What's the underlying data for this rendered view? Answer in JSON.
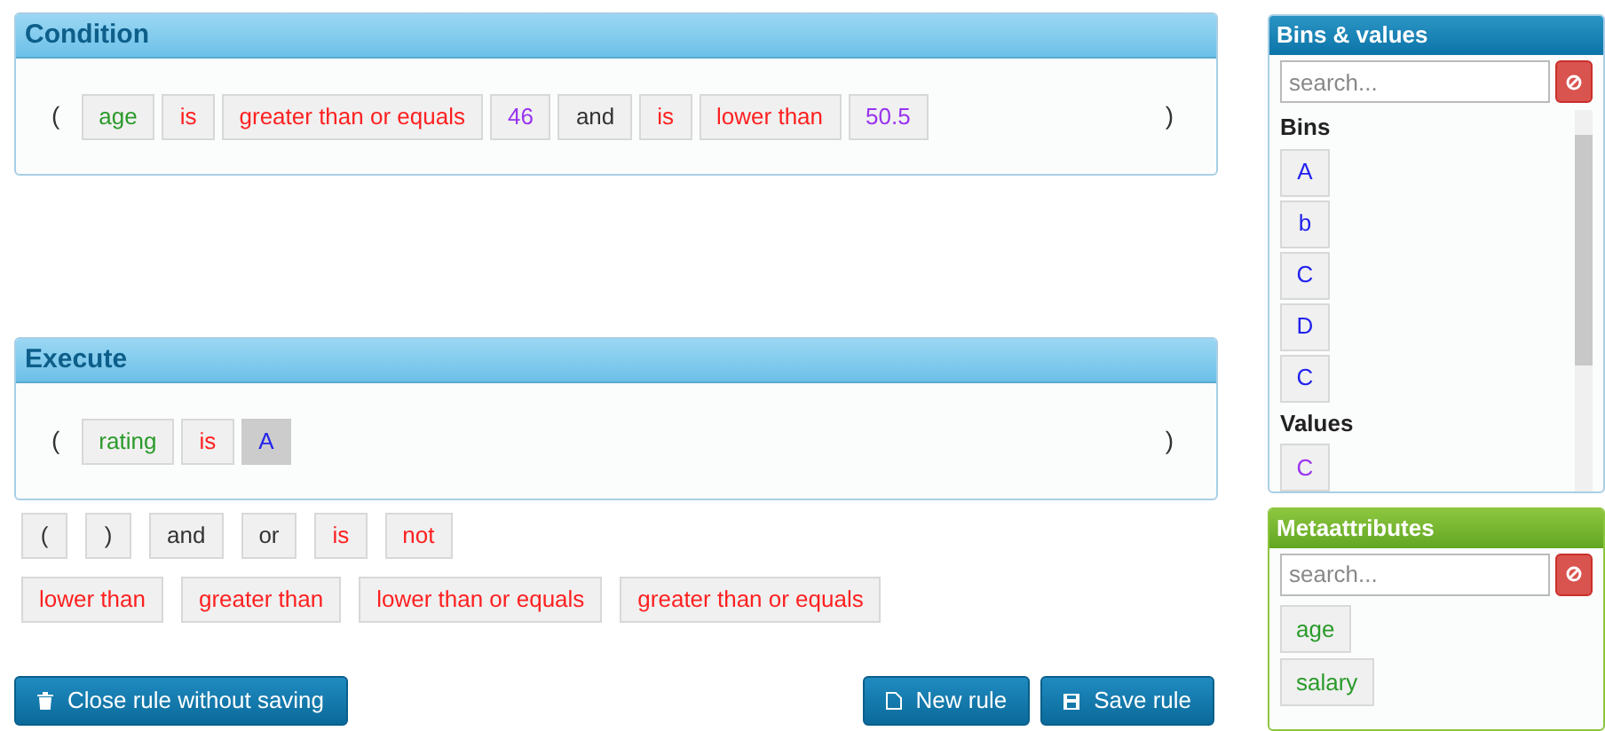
{
  "condition": {
    "title": "Condition",
    "open": "(",
    "close": ")",
    "tokens": [
      {
        "text": "age",
        "kind": "attribute"
      },
      {
        "text": "is",
        "kind": "operator"
      },
      {
        "text": "greater than or equals",
        "kind": "operator"
      },
      {
        "text": "46",
        "kind": "value"
      },
      {
        "text": "and",
        "kind": "logic"
      },
      {
        "text": "is",
        "kind": "operator"
      },
      {
        "text": "lower than",
        "kind": "operator"
      },
      {
        "text": "50.5",
        "kind": "value"
      }
    ]
  },
  "execute": {
    "title": "Execute",
    "open": "(",
    "close": ")",
    "tokens": [
      {
        "text": "rating",
        "kind": "attribute",
        "selected": false
      },
      {
        "text": "is",
        "kind": "operator",
        "selected": false
      },
      {
        "text": "A",
        "kind": "bin",
        "selected": true
      }
    ]
  },
  "palette_rows": [
    [
      {
        "text": "(",
        "kind": "logic"
      },
      {
        "text": ")",
        "kind": "logic"
      },
      {
        "text": "and",
        "kind": "logic"
      },
      {
        "text": "or",
        "kind": "logic"
      },
      {
        "text": "is",
        "kind": "operator"
      },
      {
        "text": "not",
        "kind": "operator"
      }
    ],
    [
      {
        "text": "lower than",
        "kind": "operator"
      },
      {
        "text": "greater than",
        "kind": "operator"
      },
      {
        "text": "lower than or equals",
        "kind": "operator"
      },
      {
        "text": "greater than or equals",
        "kind": "operator"
      }
    ]
  ],
  "buttons": {
    "close": "Close rule without saving",
    "new": "New rule",
    "save": "Save rule"
  },
  "bins_panel": {
    "title": "Bins & values",
    "search": {
      "placeholder": "search..."
    },
    "sections": [
      {
        "heading": "Bins",
        "items": [
          {
            "text": "A",
            "kind": "bin"
          },
          {
            "text": "b",
            "kind": "bin"
          },
          {
            "text": "C",
            "kind": "bin"
          },
          {
            "text": "D",
            "kind": "bin"
          },
          {
            "text": "C",
            "kind": "bin"
          }
        ]
      },
      {
        "heading": "Values",
        "items": [
          {
            "text": "C",
            "kind": "value"
          }
        ]
      }
    ]
  },
  "meta_panel": {
    "title": "Metaattributes",
    "search": {
      "placeholder": "search..."
    },
    "items": [
      {
        "text": "age",
        "kind": "attribute"
      },
      {
        "text": "salary",
        "kind": "attribute"
      }
    ]
  }
}
